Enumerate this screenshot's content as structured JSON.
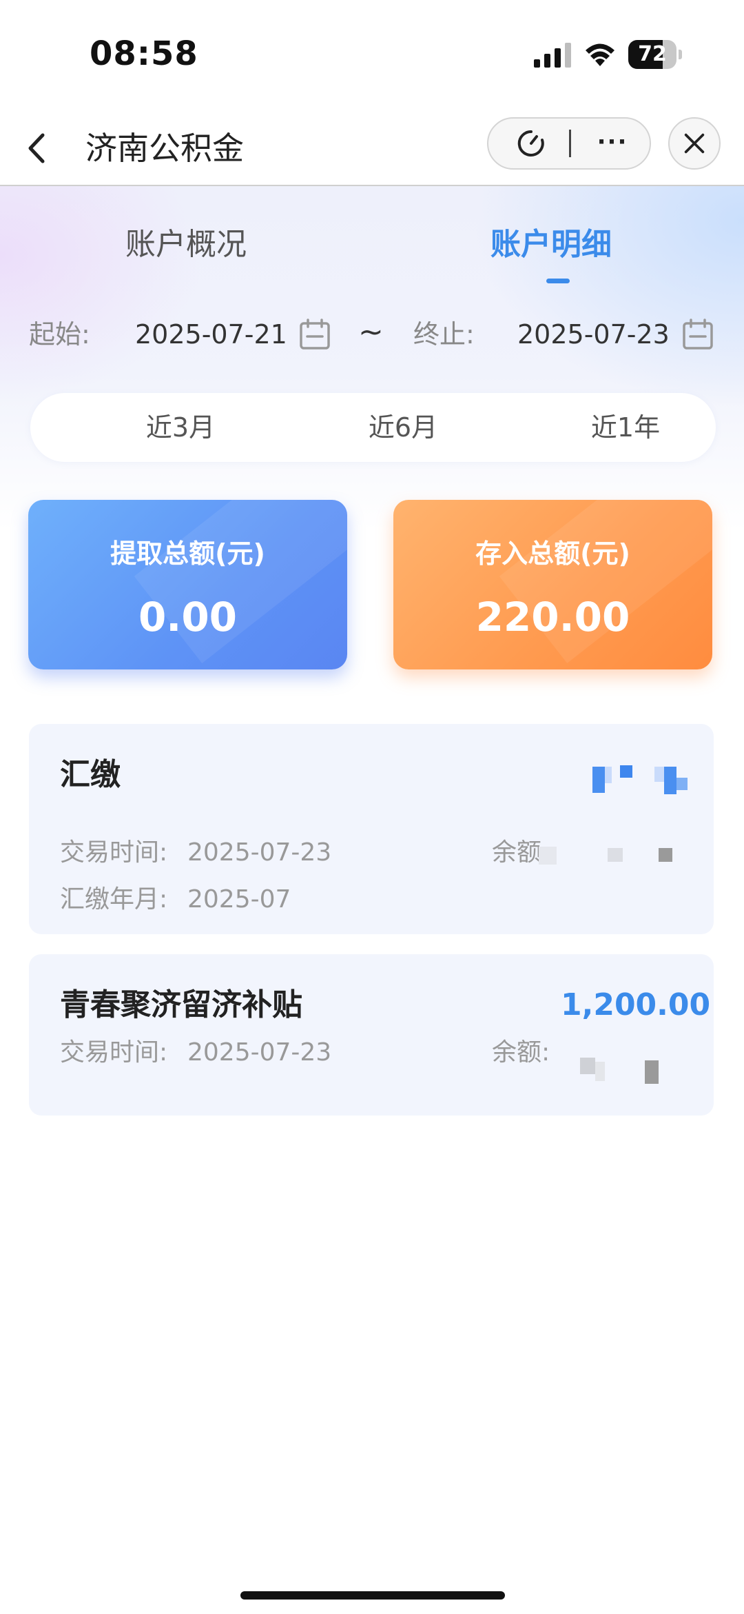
{
  "status_bar": {
    "time": "08:58",
    "battery": "72",
    "battery_level": 0.72
  },
  "nav": {
    "title": "济南公积金",
    "more": "···"
  },
  "tabs": {
    "overview": "账户概况",
    "detail": "账户明细"
  },
  "date_range": {
    "start_label": "起始:",
    "start_value": "2025-07-21",
    "separator": "~",
    "end_label": "终止:",
    "end_value": "2025-07-23"
  },
  "quick_ranges": [
    "近3月",
    "近6月",
    "近1年"
  ],
  "summary": {
    "withdraw_label": "提取总额(元)",
    "withdraw_value": "0.00",
    "deposit_label": "存入总额(元)",
    "deposit_value": "220.00"
  },
  "transactions": [
    {
      "title": "汇缴",
      "time_label": "交易时间:",
      "time_value": "2025-07-23",
      "month_label": "汇缴年月:",
      "month_value": "2025-07",
      "balance_label": "余额"
    },
    {
      "title": "青春聚济留济补贴",
      "amount": "1,200.00",
      "time_label": "交易时间:",
      "time_value": "2025-07-23",
      "balance_label": "余额:"
    }
  ],
  "colors": {
    "accent": "#3b8bea",
    "withdraw_card": "#5e93f6",
    "deposit_card": "#ff9a4f",
    "item_bg": "#f2f5fd"
  }
}
